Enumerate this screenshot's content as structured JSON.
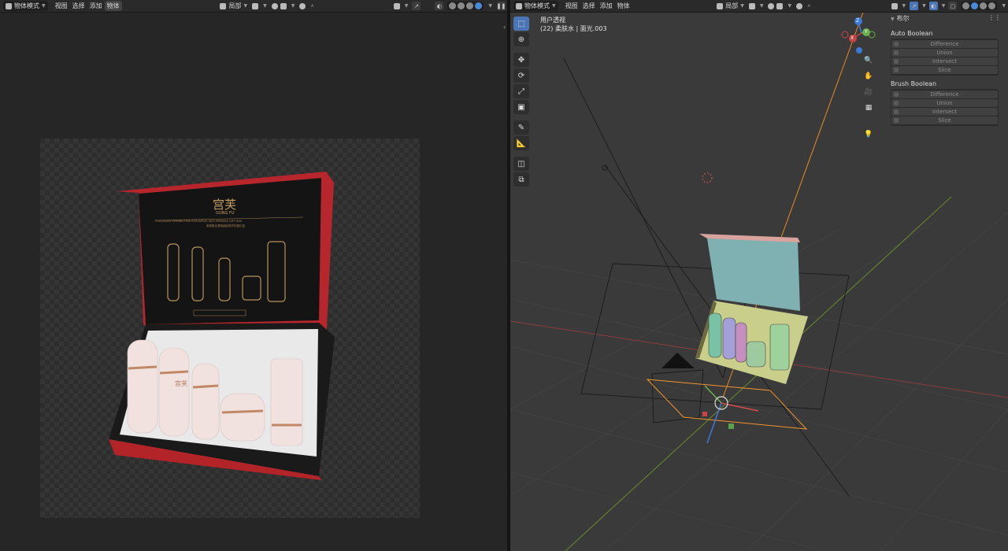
{
  "left_header": {
    "mode": "物体模式",
    "menus": [
      "视图",
      "选择",
      "添加",
      "物体"
    ],
    "active_menu": "物体",
    "pivot": "局部"
  },
  "right_header": {
    "mode": "物体模式",
    "menus": [
      "视图",
      "选择",
      "添加",
      "物体"
    ],
    "pivot": "局部"
  },
  "render": {
    "brand_cn": "宫芙",
    "brand_en": "GONG FU",
    "line1": "COLLAGEN FIRMING FINE-RESHAPING ANTI-WRINKLE GIFT BOX",
    "line2": "胶原蛋白紧致细纹修护抗皱礼盒",
    "bottle_label": "宫芙"
  },
  "viewport": {
    "view_name": "用户透视",
    "object_name": "(22) 柔肤水 | 面光.003"
  },
  "gizmo": {
    "z": "Z",
    "y": "Y",
    "x": "X"
  },
  "npanel": {
    "tab": "布尔",
    "auto_title": "Auto Boolean",
    "auto_buttons": [
      "Difference",
      "Union",
      "Intersect",
      "Slice"
    ],
    "brush_title": "Brush Boolean",
    "brush_buttons": [
      "Difference",
      "Union",
      "Intersect",
      "Slice"
    ]
  },
  "colors": {
    "accent": "#4a76b8",
    "selection_orange": "#f0962c",
    "axis_red": "#a83a3a",
    "axis_green": "#6a9a2a"
  }
}
